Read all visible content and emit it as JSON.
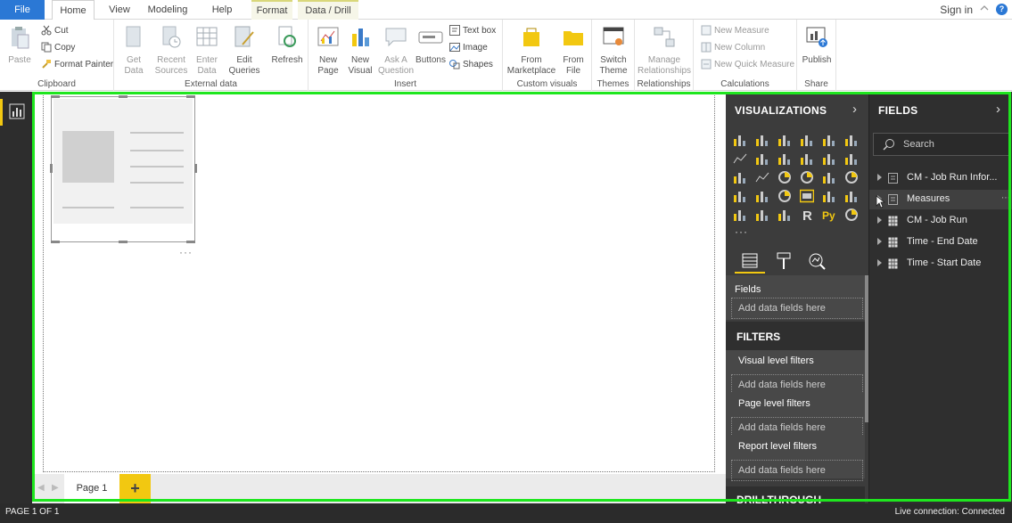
{
  "ribbon_tabs": {
    "file": "File",
    "home": "Home",
    "view": "View",
    "modeling": "Modeling",
    "help": "Help",
    "format": "Format",
    "data_drill": "Data / Drill"
  },
  "account": {
    "sign_in": "Sign in",
    "help_glyph": "?"
  },
  "groups": {
    "clipboard": {
      "label": "Clipboard",
      "paste": "Paste",
      "cut": "Cut",
      "copy": "Copy",
      "format_painter": "Format Painter"
    },
    "external_data": {
      "label": "External data",
      "get_data": "Get Data",
      "recent_sources": "Recent Sources",
      "enter_data": "Enter Data",
      "edit_queries": "Edit Queries",
      "refresh": "Refresh"
    },
    "insert": {
      "label": "Insert",
      "new_page": "New Page",
      "new_visual": "New Visual",
      "ask_question": "Ask A Question",
      "buttons": "Buttons",
      "text_box": "Text box",
      "image": "Image",
      "shapes": "Shapes"
    },
    "custom_visuals": {
      "label": "Custom visuals",
      "from_marketplace": "From Marketplace",
      "from_file": "From File"
    },
    "themes": {
      "label": "Themes",
      "switch_theme": "Switch Theme"
    },
    "relationships": {
      "label": "Relationships",
      "manage": "Manage Relationships"
    },
    "calculations": {
      "label": "Calculations",
      "new_measure": "New Measure",
      "new_column": "New Column",
      "new_quick_measure": "New Quick Measure"
    },
    "share": {
      "label": "Share",
      "publish": "Publish"
    }
  },
  "canvas": {
    "visual_more": "···"
  },
  "pages": {
    "tabs": [
      {
        "label": "Page 1"
      }
    ],
    "add_label": "+"
  },
  "visualizations": {
    "title": "VISUALIZATIONS",
    "more": "···",
    "fields_label": "Fields",
    "add_fields": "Add data fields here"
  },
  "filters": {
    "title": "FILTERS",
    "sections": [
      {
        "label": "Visual level filters",
        "placeholder": "Add data fields here"
      },
      {
        "label": "Page level filters",
        "placeholder": "Add data fields here"
      },
      {
        "label": "Report level filters",
        "placeholder": "Add data fields here"
      }
    ],
    "drillthrough": "DRILLTHROUGH"
  },
  "fields": {
    "title": "FIELDS",
    "search_placeholder": "Search",
    "tables": [
      {
        "name": "CM - Job Run Infor...",
        "kind": "table-icon"
      },
      {
        "name": "Measures",
        "kind": "table-icon"
      },
      {
        "name": "CM - Job Run",
        "kind": "table-icon"
      },
      {
        "name": "Time - End Date",
        "kind": "table-icon"
      },
      {
        "name": "Time - Start Date",
        "kind": "table-icon"
      }
    ]
  },
  "status": {
    "page": "PAGE 1 OF 1",
    "connection": "Live connection: Connected"
  },
  "colors": {
    "accent_yellow": "#f2c811",
    "file_blue": "#2b78d5",
    "focus_green": "#1ee61e",
    "pane_dark": "#3c3c3c"
  }
}
